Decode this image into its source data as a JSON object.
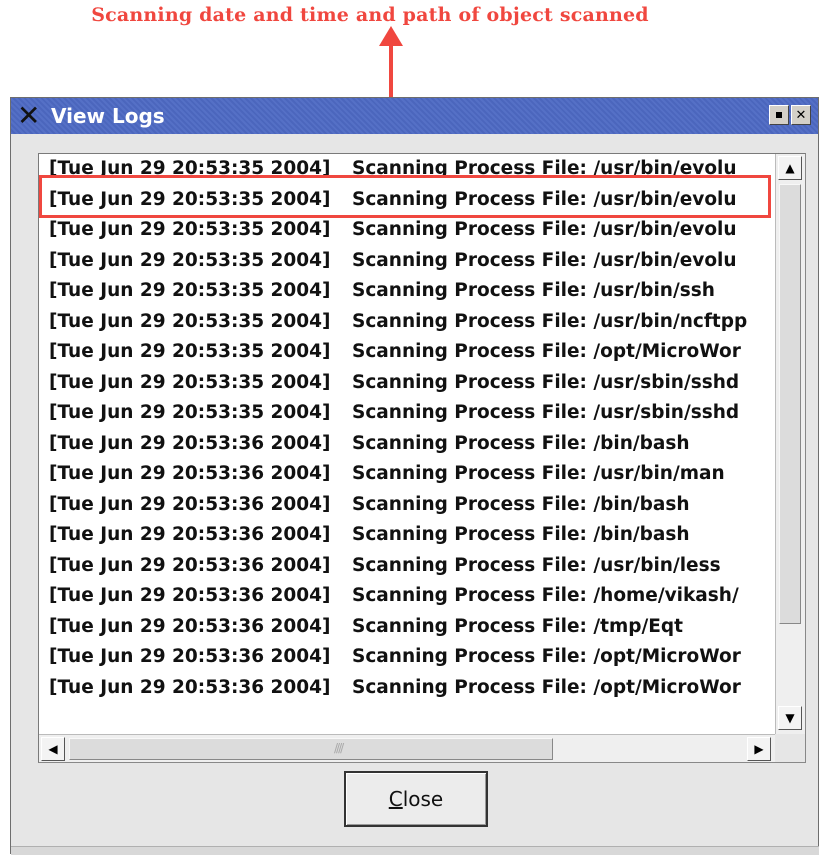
{
  "annotation": {
    "text": "Scanning date and time and path of object scanned",
    "color": "#f0473f"
  },
  "window": {
    "title": "View Logs",
    "app_icon": "x-window-logo-icon",
    "title_bar_color": "#4b66bd",
    "minimize_icon": "minimize-icon",
    "close_icon": "close-icon",
    "close_glyph": "✕"
  },
  "log": {
    "rows": [
      {
        "ts": "[Tue Jun 29 20:53:35 2004]",
        "msg": "Scanning Process File: /usr/bin/evolu"
      },
      {
        "ts": "[Tue Jun 29 20:53:35 2004]",
        "msg": "Scanning Process File: /usr/bin/evolu"
      },
      {
        "ts": "[Tue Jun 29 20:53:35 2004]",
        "msg": "Scanning Process File: /usr/bin/evolu"
      },
      {
        "ts": "[Tue Jun 29 20:53:35 2004]",
        "msg": "Scanning Process File: /usr/bin/evolu"
      },
      {
        "ts": "[Tue Jun 29 20:53:35 2004]",
        "msg": "Scanning Process File: /usr/bin/ssh"
      },
      {
        "ts": "[Tue Jun 29 20:53:35 2004]",
        "msg": "Scanning Process File: /usr/bin/ncftpp"
      },
      {
        "ts": "[Tue Jun 29 20:53:35 2004]",
        "msg": "Scanning Process File: /opt/MicroWor"
      },
      {
        "ts": "[Tue Jun 29 20:53:35 2004]",
        "msg": "Scanning Process File: /usr/sbin/sshd"
      },
      {
        "ts": "[Tue Jun 29 20:53:35 2004]",
        "msg": "Scanning Process File: /usr/sbin/sshd"
      },
      {
        "ts": "[Tue Jun 29 20:53:36 2004]",
        "msg": "Scanning Process File: /bin/bash"
      },
      {
        "ts": "[Tue Jun 29 20:53:36 2004]",
        "msg": "Scanning Process File: /usr/bin/man"
      },
      {
        "ts": "[Tue Jun 29 20:53:36 2004]",
        "msg": "Scanning Process File: /bin/bash"
      },
      {
        "ts": "[Tue Jun 29 20:53:36 2004]",
        "msg": "Scanning Process File: /bin/bash"
      },
      {
        "ts": "[Tue Jun 29 20:53:36 2004]",
        "msg": "Scanning Process File: /usr/bin/less"
      },
      {
        "ts": "[Tue Jun 29 20:53:36 2004]",
        "msg": "Scanning Process File: /home/vikash/"
      },
      {
        "ts": "[Tue Jun 29 20:53:36 2004]",
        "msg": "Scanning Process File: /tmp/Eqt"
      },
      {
        "ts": "[Tue Jun 29 20:53:36 2004]",
        "msg": "Scanning Process File: /opt/MicroWor"
      },
      {
        "ts": "[Tue Jun 29 20:53:36 2004]",
        "msg": "Scanning Process File: /opt/MicroWor"
      }
    ]
  },
  "scrollbars": {
    "up_icon": "scroll-up-arrow-icon",
    "down_icon": "scroll-down-arrow-icon",
    "left_icon": "scroll-left-arrow-icon",
    "right_icon": "scroll-right-arrow-icon",
    "up_glyph": "▲",
    "down_glyph": "▼",
    "left_glyph": "◀",
    "right_glyph": "▶"
  },
  "buttons": {
    "close_mnemonic": "C",
    "close_rest": "lose"
  }
}
